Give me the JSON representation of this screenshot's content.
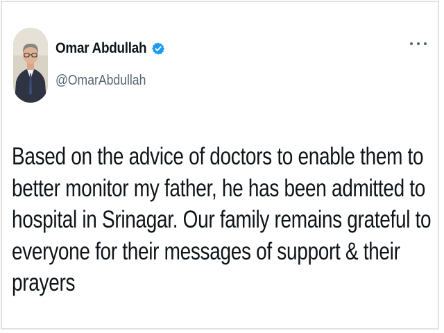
{
  "tweet": {
    "author": {
      "display_name": "Omar Abdullah",
      "handle": "@OmarAbdullah",
      "verified": true,
      "avatar_icon": "profile-photo"
    },
    "more_icon": "ellipsis-icon",
    "text_lines": [
      "Based on the advice of doctors to enable them to",
      "better monitor my father, he has been admitted to",
      "hospital in Srinagar. Our family remains grateful to",
      "everyone for their messages of support & their prayers"
    ]
  },
  "colors": {
    "verified_badge": "#1d9bf0",
    "handle_text": "#536471",
    "body_text": "#0f1419",
    "border": "#dfe3e6"
  }
}
